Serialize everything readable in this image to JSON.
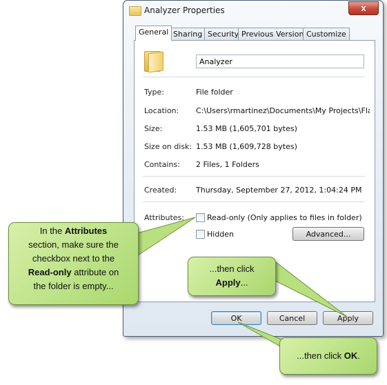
{
  "window": {
    "title": "Analyzer Properties",
    "close_glyph": "x"
  },
  "tabs": [
    "General",
    "Sharing",
    "Security",
    "Previous Versions",
    "Customize"
  ],
  "active_tab": "General",
  "general": {
    "name_value": "Analyzer",
    "rows": [
      {
        "label": "Type:",
        "value": "File folder"
      },
      {
        "label": "Location:",
        "value": "C:\\Users\\rmartinez\\Documents\\My Projects\\Flare P"
      },
      {
        "label": "Size:",
        "value": "1.53 MB (1,605,701 bytes)"
      },
      {
        "label": "Size on disk:",
        "value": "1.53 MB (1,609,728 bytes)"
      },
      {
        "label": "Contains:",
        "value": "2 Files, 1 Folders"
      },
      {
        "label": "Created:",
        "value": "Thursday, September 27, 2012, 1:04:24 PM"
      }
    ],
    "attributes_label": "Attributes:",
    "readonly_label": "Read-only (Only applies to files in folder)",
    "readonly_checked": false,
    "hidden_label": "Hidden",
    "hidden_checked": false,
    "advanced_button": "Advanced..."
  },
  "buttons": {
    "ok": "OK",
    "cancel": "Cancel",
    "apply": "Apply"
  },
  "callouts": {
    "attributes": {
      "line1_pre": "In the ",
      "line1_bold": "Attributes",
      "line2": "section, make sure the",
      "line3": "checkbox next to the",
      "line4_bold": "Read-only",
      "line4_post": " attribute on",
      "line5": "the folder is empty..."
    },
    "apply": {
      "line1": "...then click",
      "line2_bold": "Apply",
      "line2_post": "..."
    },
    "ok": {
      "pre": "...then click ",
      "bold": "OK",
      "post": "."
    }
  },
  "colors": {
    "callout_fill": "#b8e07e",
    "callout_border": "#6d8f3f",
    "close_button": "#c74a3a"
  },
  "icons": [
    "folder-icon",
    "close-icon",
    "checkbox-icon"
  ]
}
